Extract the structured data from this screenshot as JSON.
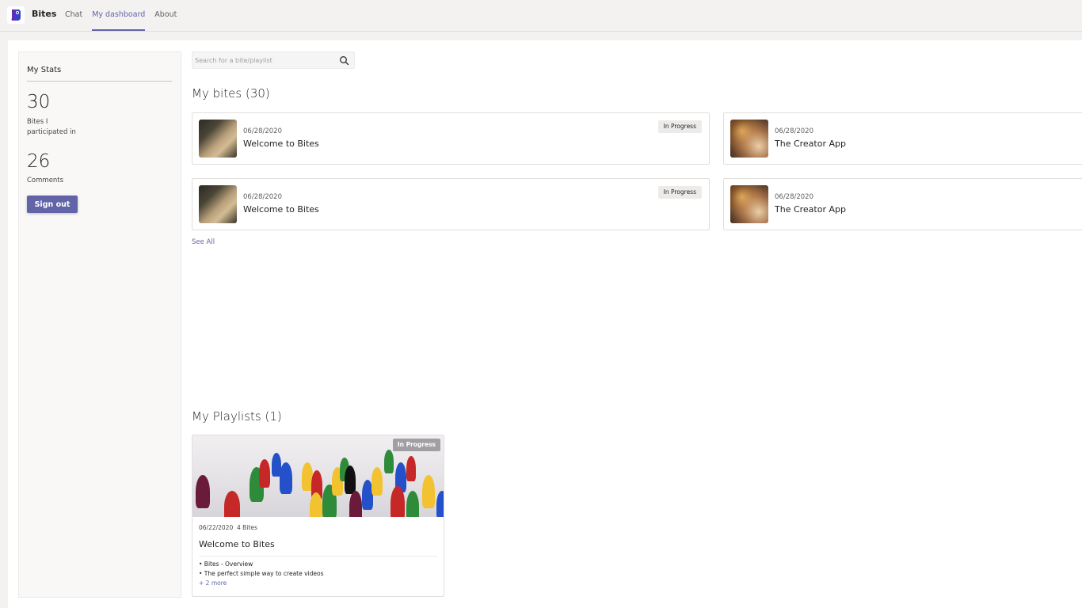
{
  "app": {
    "name": "Bites",
    "nav": [
      {
        "label": "Chat",
        "active": false
      },
      {
        "label": "My dashboard",
        "active": true
      },
      {
        "label": "About",
        "active": false
      }
    ]
  },
  "stats": {
    "title": "My Stats",
    "items": [
      {
        "value": "30",
        "label": "Bites I participated in"
      },
      {
        "value": "26",
        "label": "Comments"
      }
    ],
    "sign_out_label": "Sign out"
  },
  "search": {
    "placeholder": "Search for a bite/playlist",
    "value": "",
    "icon": "search-icon"
  },
  "bites": {
    "title": "My bites (30)",
    "see_all_label": "See All",
    "cards": [
      {
        "date": "06/28/2020",
        "title": "Welcome to Bites",
        "status": "In Progress",
        "thumb": "welcome"
      },
      {
        "date": "06/28/2020",
        "title": "The Creator App",
        "status": "",
        "thumb": "creator"
      },
      {
        "date": "06/28/2020",
        "title": "Welcome to Bites",
        "status": "In Progress",
        "thumb": "welcome"
      },
      {
        "date": "06/28/2020",
        "title": "The Creator App",
        "status": "",
        "thumb": "creator"
      }
    ]
  },
  "playlists": {
    "title": "My Playlists (1)",
    "cards": [
      {
        "status": "In Progress",
        "date": "06/22/2020",
        "count": "4 Bites",
        "title": "Welcome to Bites",
        "items": [
          "• Bites - Overview",
          "• The perfect simple way to create videos"
        ],
        "more": "+ 2 more"
      }
    ]
  },
  "colors": {
    "accent": "#6264a7",
    "background": "#f3f2f1",
    "panel": "#ffffff",
    "badge": "#edebe9"
  }
}
